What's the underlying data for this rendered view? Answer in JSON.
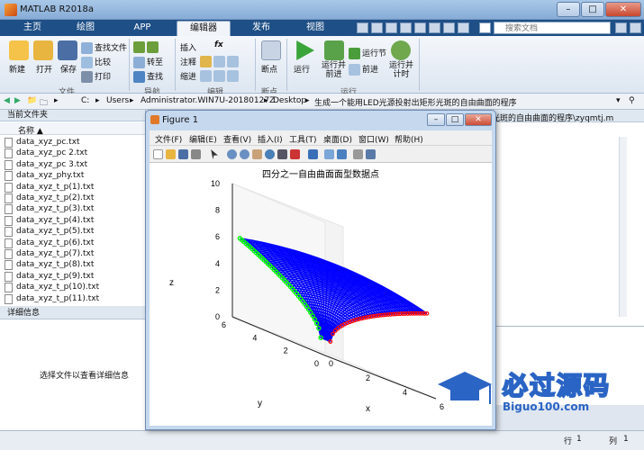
{
  "app": {
    "title": "MATLAB R2018a"
  },
  "window_buttons": {
    "minimize": "–",
    "maximize": "□",
    "close": "✕"
  },
  "tabs": [
    "主页",
    "绘图",
    "APP",
    "编辑器",
    "发布",
    "视图"
  ],
  "search": {
    "placeholder": "搜索文档"
  },
  "ribbon": {
    "file": {
      "new": "新建",
      "open": "打开",
      "save": "保存",
      "find_files": "查找文件",
      "compare": "比较",
      "print": "打印",
      "group": "文件"
    },
    "nav": {
      "goto": "转至",
      "find": "查找",
      "group": "导航"
    },
    "edit": {
      "insert": "插入",
      "comment": "注释",
      "indent": "缩进",
      "fx": "fx",
      "group": "编辑"
    },
    "breakpoints": {
      "label": "断点",
      "group": "断点"
    },
    "run": {
      "run": "运行",
      "run_advance": "运行并\n前进",
      "run_section": "运行节",
      "advance": "前进",
      "run_time": "运行并\n计时",
      "group": "运行"
    }
  },
  "address": {
    "parts": [
      "C:",
      "Users",
      "Administrator.WIN7U-20180127Z",
      "Desktop",
      "生成一个能用LED光源投射出矩形光斑的自由曲面的程序"
    ]
  },
  "folder_pane": {
    "title": "当前文件夹",
    "column": "名称 ▲",
    "files": [
      "data_xyz_pc.txt",
      "data_xyz_pc 2.txt",
      "data_xyz_pc 3.txt",
      "data_xyz_phy.txt",
      "data_xyz_t_p(1).txt",
      "data_xyz_t_p(2).txt",
      "data_xyz_t_p(3).txt",
      "data_xyz_t_p(4).txt",
      "data_xyz_t_p(5).txt",
      "data_xyz_t_p(6).txt",
      "data_xyz_t_p(7).txt",
      "data_xyz_t_p(8).txt",
      "data_xyz_t_p(9).txt",
      "data_xyz_t_p(10).txt",
      "data_xyz_t_p(11).txt"
    ]
  },
  "details_pane": {
    "title": "详细信息",
    "hint": "选择文件以查看详细信息"
  },
  "editor": {
    "path_fragment": "光斑的自由曲面的程序\\zyqmtj.m"
  },
  "status": {
    "row_label": "行",
    "row": "1",
    "col_label": "列",
    "col": "1"
  },
  "figure": {
    "title": "Figure 1",
    "menu": [
      "文件(F)",
      "编辑(E)",
      "查看(V)",
      "插入(I)",
      "工具(T)",
      "桌面(D)",
      "窗口(W)",
      "帮助(H)"
    ]
  },
  "chart_data": {
    "type": "surface3d",
    "title": "四分之一自由曲面面型数据点",
    "xlabel": "x",
    "ylabel": "y",
    "zlabel": "z",
    "xlim": [
      0,
      6
    ],
    "ylim": [
      0,
      6
    ],
    "zlim": [
      0,
      10
    ],
    "x_ticks": [
      "0",
      "2",
      "4",
      "6"
    ],
    "y_ticks": [
      "0",
      "2",
      "4",
      "6"
    ],
    "z_ticks": [
      "0",
      "2",
      "4",
      "6",
      "8",
      "10"
    ],
    "series": [
      {
        "color": "#0000ff",
        "style": "dense curve family"
      },
      {
        "color": "#00ff00",
        "style": "boundary markers"
      },
      {
        "color": "#ff0000",
        "style": "boundary markers"
      }
    ]
  },
  "watermark": {
    "text": "必过源码",
    "url": "Biguo100.com"
  },
  "colors": {
    "accent": "#1e4f86",
    "surface": "#0000ff",
    "edge_green": "#00ff00",
    "edge_red": "#ff0000"
  }
}
